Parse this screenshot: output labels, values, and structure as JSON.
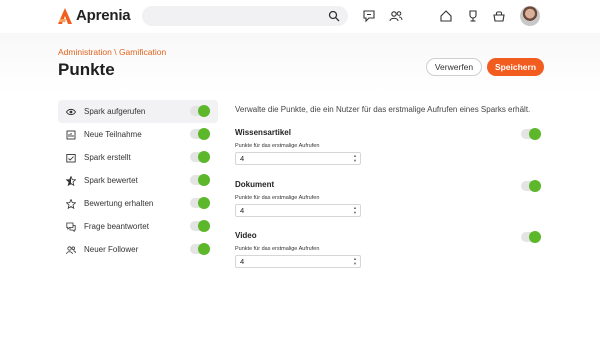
{
  "app": {
    "name": "Aprenia"
  },
  "search": {
    "placeholder": ""
  },
  "header": {
    "breadcrumb": "Administration \\ Gamification",
    "title": "Punkte",
    "discard_label": "Verwerfen",
    "save_label": "Speichern"
  },
  "sidebar": {
    "items": [
      {
        "label": "Spark aufgerufen",
        "icon": "eye-icon",
        "enabled": true,
        "active": true
      },
      {
        "label": "Neue Teilnahme",
        "icon": "participation-icon",
        "enabled": true,
        "active": false
      },
      {
        "label": "Spark erstellt",
        "icon": "create-icon",
        "enabled": true,
        "active": false
      },
      {
        "label": "Spark bewertet",
        "icon": "star-half-icon",
        "enabled": true,
        "active": false
      },
      {
        "label": "Bewertung erhalten",
        "icon": "star-icon",
        "enabled": true,
        "active": false
      },
      {
        "label": "Frage beantwortet",
        "icon": "chat-icon",
        "enabled": true,
        "active": false
      },
      {
        "label": "Neuer Follower",
        "icon": "users-icon",
        "enabled": true,
        "active": false
      }
    ]
  },
  "content": {
    "intro": "Verwalte die Punkte, die ein Nutzer für das erstmalige Aufrufen eines Sparks erhält.",
    "sections": [
      {
        "title": "Wissensartikel",
        "field_label": "Punkte für das erstmalige Aufrufen",
        "value": "4",
        "enabled": true
      },
      {
        "title": "Dokument",
        "field_label": "Punkte für das erstmalige Aufrufen",
        "value": "4",
        "enabled": true
      },
      {
        "title": "Video",
        "field_label": "Punkte für das erstmalige Aufrufen",
        "value": "4",
        "enabled": true
      }
    ]
  },
  "colors": {
    "accent": "#f25c1f",
    "toggle_on": "#5cb82a",
    "breadcrumb": "#e0631c"
  }
}
